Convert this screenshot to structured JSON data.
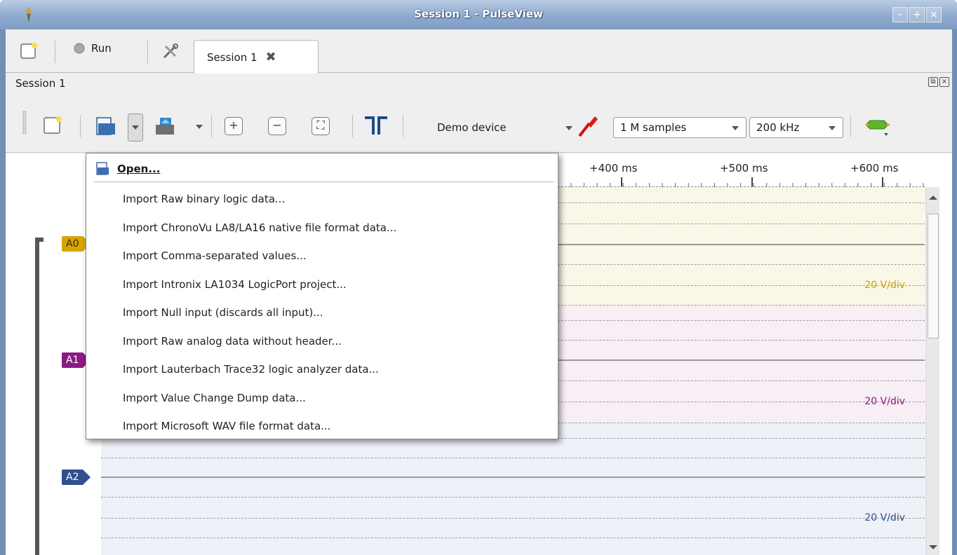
{
  "window": {
    "title": "Session 1 - PulseView"
  },
  "main_toolbar": {
    "run_label": "Run",
    "tab_label": "Session 1"
  },
  "session": {
    "label": "Session 1"
  },
  "device_toolbar": {
    "device": "Demo device",
    "samples": "1 M samples",
    "rate": "200 kHz"
  },
  "ruler": {
    "ticks": [
      "+400 ms",
      "+500 ms",
      "+600 ms"
    ]
  },
  "channels": [
    {
      "name": "A0",
      "color": "#d4a600",
      "band_color": "#faf7e8",
      "scale": "20 V/div"
    },
    {
      "name": "A1",
      "color": "#8c1a84",
      "band_color": "#f8eef5",
      "scale": "20 V/div"
    },
    {
      "name": "A2",
      "color": "#2f4f90",
      "band_color": "#eef1f7",
      "scale": "20 V/div"
    }
  ],
  "open_menu": {
    "open_label": "Open...",
    "items": [
      "Import Raw binary logic data...",
      "Import ChronoVu LA8/LA16 native file format data...",
      "Import Comma-separated values...",
      "Import Intronix LA1034 LogicPort project...",
      "Import Null input (discards all input)...",
      "Import Raw analog data without header...",
      "Import Lauterbach Trace32 logic analyzer data...",
      "Import Value Change Dump data...",
      "Import Microsoft WAV file format data..."
    ]
  }
}
